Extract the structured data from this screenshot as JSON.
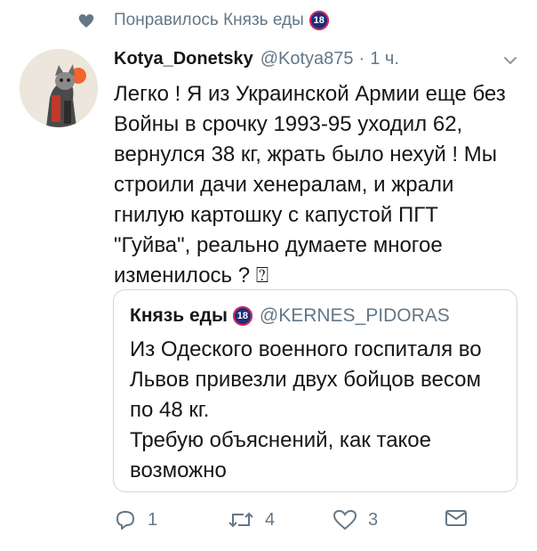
{
  "social_context": {
    "text": "Понравилось Князь еды",
    "badge": "18"
  },
  "tweet": {
    "name": "Kotya_Donetsky",
    "handle": "@Kotya875",
    "separator": "·",
    "time": "1 ч.",
    "text": "Легко ! Я из Украинской Армии еще без Войны в срочку 1993-95 уходил 62, вернулся 38 кг, жрать было нехуй ! Мы строили дачи хенералам, и жрали гнилую картошку с капустой ПГТ \"Гуйва\", реально думаете многое изменилось ? ⍰"
  },
  "quoted": {
    "name": "Князь еды",
    "badge": "18",
    "handle": "@KERNES_PIDORAS",
    "text": "Из Одеского военного госпиталя во Львов привезли двух бойцов весом по 48 кг.\nТребую объяснений, как такое возможно"
  },
  "actions": {
    "reply_count": "1",
    "retweet_count": "4",
    "like_count": "3"
  },
  "colors": {
    "muted": "#657786",
    "border": "#ccd6dd",
    "text": "#14171a"
  }
}
